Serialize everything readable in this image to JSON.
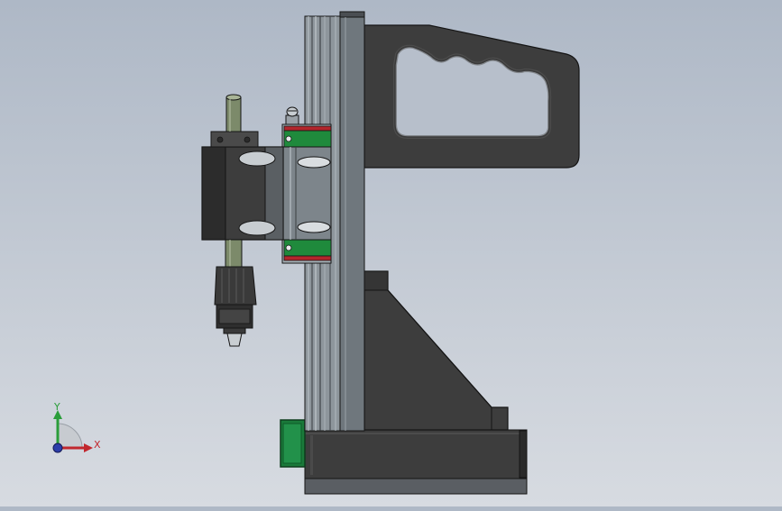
{
  "viewport": {
    "background_top": "#aeb8c6",
    "background_bottom": "#d7dbe1"
  },
  "model": {
    "body_color": "#3d3d3d",
    "edge_color": "#151515",
    "metal_color": "#8e969c",
    "rail_color": "#b9c0c6",
    "guide_green": "#1f8a3c",
    "guide_red": "#b3262c",
    "shaft_color": "#7c8a6a",
    "switch_color": "#1a7a3a"
  },
  "triad": {
    "x_label": "X",
    "y_label": "Y",
    "x_color": "#c1272d",
    "y_color": "#2a9d3a",
    "z_color": "#2c3eaa"
  }
}
